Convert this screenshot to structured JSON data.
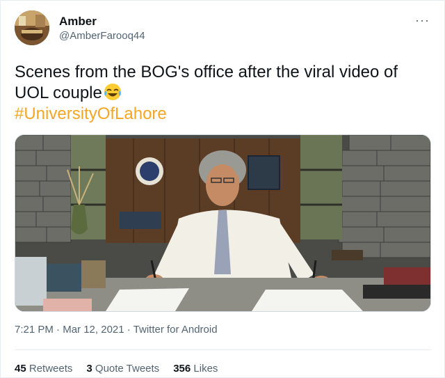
{
  "author": {
    "name": "Amber",
    "handle": "@AmberFarooq44"
  },
  "more_label": "···",
  "tweet": {
    "text": "Scenes from the BOG's office after the viral video of UOL couple",
    "emoji": "face-with-tears-of-joy-icon",
    "hashtag": "#UniversityOfLahore"
  },
  "meta": {
    "time": "7:21 PM",
    "separator": " · ",
    "date": "Mar 12, 2021",
    "source": "Twitter for Android"
  },
  "stats": {
    "retweets_count": "45",
    "retweets_label": "Retweets",
    "quotes_count": "3",
    "quotes_label": "Quote Tweets",
    "likes_count": "356",
    "likes_label": "Likes"
  },
  "colors": {
    "hashtag": "#f5a623",
    "secondary_text": "#536471",
    "primary_text": "#0f1419"
  }
}
